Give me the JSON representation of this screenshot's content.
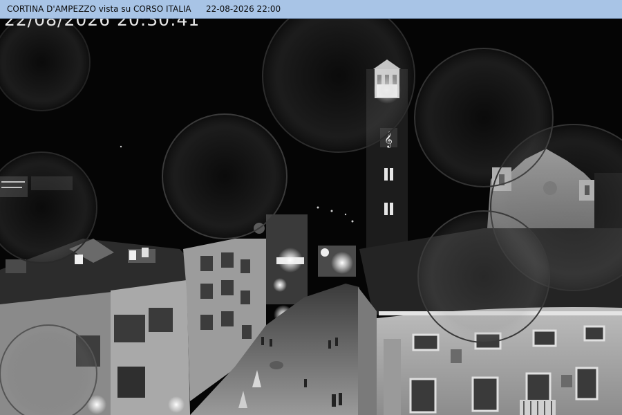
{
  "header": {
    "title": "CORTINA D'AMPEZZO vista su CORSO ITALIA",
    "datetime": "22-08-2026 22:00"
  },
  "camera": {
    "timestamp_overlay": "22/08/2026 20:30:41"
  },
  "colors": {
    "header_background": "#a8c4e6",
    "night_sky": "#050505"
  }
}
